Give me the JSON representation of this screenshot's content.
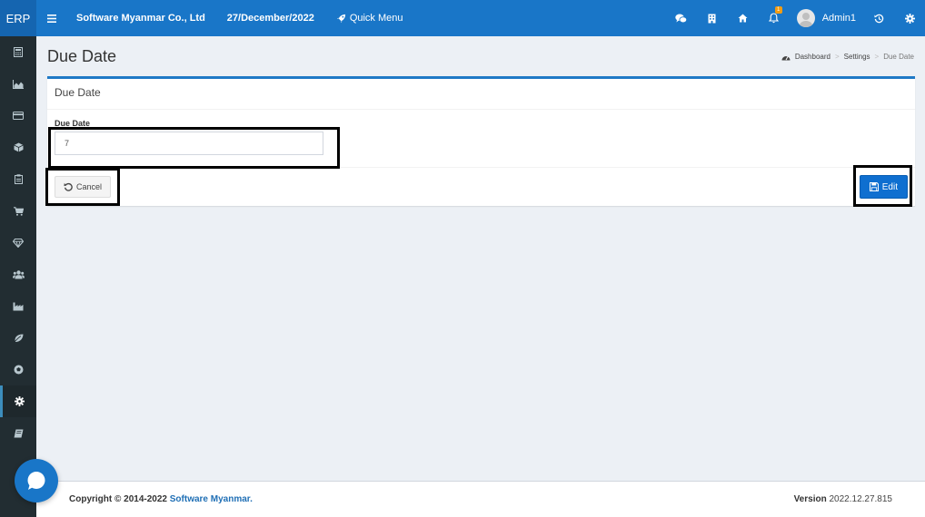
{
  "topbar": {
    "brand": "ERP",
    "company": "Software Myanmar Co., Ltd",
    "date": "27/December/2022",
    "quick_menu": "Quick Menu",
    "notification_count": "1",
    "user_name": "Admin1"
  },
  "sidebar": {
    "items": [
      {
        "icon": "calculator-icon"
      },
      {
        "icon": "area-chart-icon"
      },
      {
        "icon": "credit-card-icon"
      },
      {
        "icon": "cube-icon"
      },
      {
        "icon": "clipboard-icon"
      },
      {
        "icon": "cart-icon"
      },
      {
        "icon": "diamond-icon"
      },
      {
        "icon": "users-icon"
      },
      {
        "icon": "industry-icon"
      },
      {
        "icon": "leaf-icon"
      },
      {
        "icon": "soccer-ball-icon"
      },
      {
        "icon": "gear-icon",
        "active": true
      },
      {
        "icon": "book-icon"
      }
    ]
  },
  "header": {
    "title": "Due Date",
    "breadcrumb": [
      "Dashboard",
      "Settings",
      "Due Date"
    ]
  },
  "box": {
    "title": "Due Date",
    "field_label": "Due Date",
    "field_value": "7",
    "cancel_label": "Cancel",
    "edit_label": "Edit"
  },
  "footer": {
    "copyright": "Copyright © 2014-2022 ",
    "company_link": "Software Myanmar.",
    "version_label": "Version",
    "version_value": " 2022.12.27.815"
  },
  "colors": {
    "topbar": "#1976c8",
    "sidebar": "#222d32",
    "accent": "#1f79c6",
    "badge": "#f39c12"
  }
}
